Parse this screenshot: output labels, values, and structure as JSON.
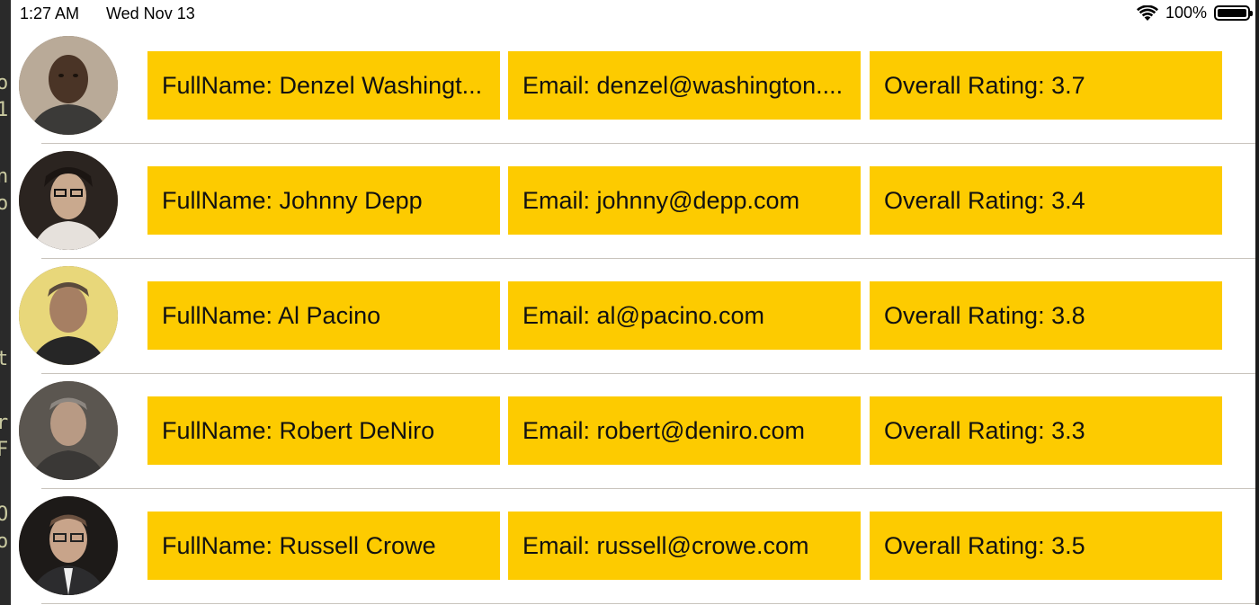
{
  "status_bar": {
    "time": "1:27 AM",
    "date": "Wed Nov 13",
    "battery": "100%",
    "icons": [
      "wifi-icon",
      "battery-icon"
    ]
  },
  "colors": {
    "cell_background": "#fdcb00",
    "separator": "#c9c4bd"
  },
  "left_edge_chars": [
    "o",
    "1",
    "n",
    "o",
    "t",
    "r",
    "F",
    "O",
    "o"
  ],
  "rows": [
    {
      "full_name": "FullName: Denzel Washingt...",
      "email": "Email: denzel@washington....",
      "rating": "Overall Rating: 3.7",
      "avatar": "denzel-washington-photo"
    },
    {
      "full_name": "FullName: Johnny Depp",
      "email": "Email: johnny@depp.com",
      "rating": "Overall Rating: 3.4",
      "avatar": "johnny-depp-photo"
    },
    {
      "full_name": "FullName: Al Pacino",
      "email": "Email: al@pacino.com",
      "rating": "Overall Rating: 3.8",
      "avatar": "al-pacino-photo"
    },
    {
      "full_name": "FullName: Robert DeNiro",
      "email": "Email: robert@deniro.com",
      "rating": "Overall Rating: 3.3",
      "avatar": "robert-deniro-photo"
    },
    {
      "full_name": "FullName: Russell Crowe",
      "email": "Email: russell@crowe.com",
      "rating": "Overall Rating: 3.5",
      "avatar": "russell-crowe-photo"
    }
  ]
}
